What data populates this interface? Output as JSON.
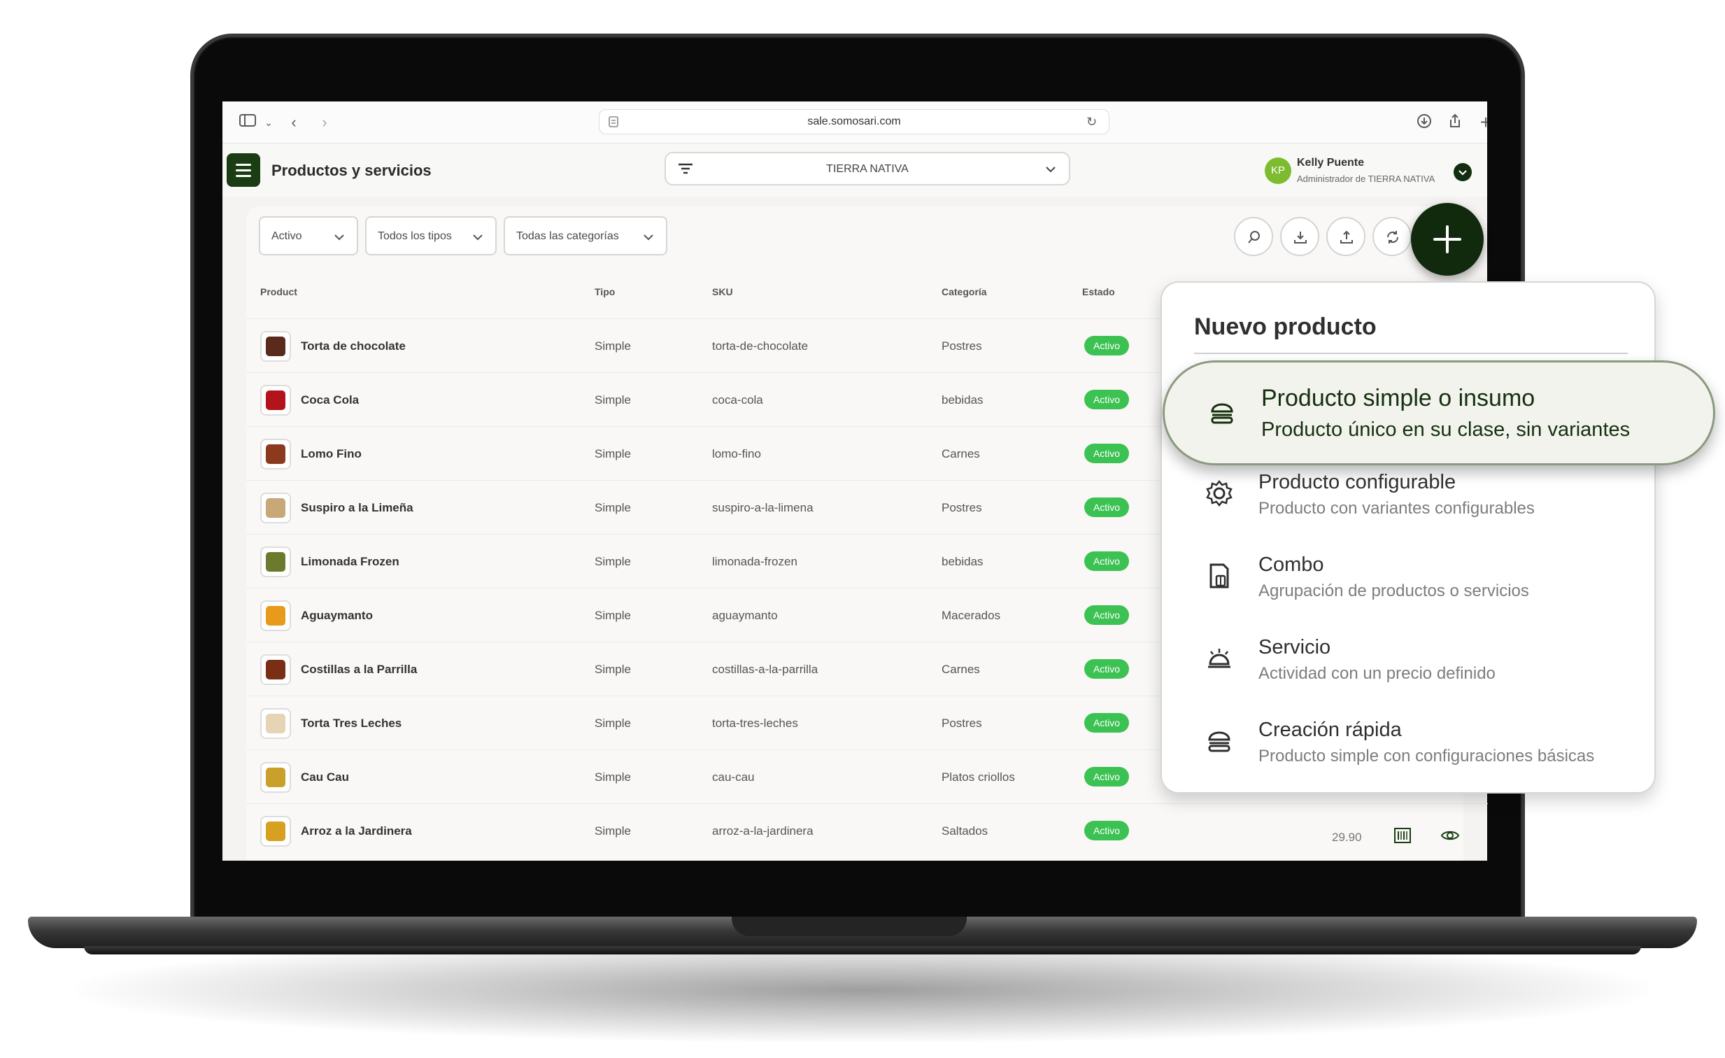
{
  "browser": {
    "url": "sale.somosari.com",
    "icons": [
      "sidebar-icon",
      "chevron-down-icon",
      "back-icon",
      "forward-icon",
      "download-icon",
      "share-icon",
      "new-tab-icon",
      "tabs-icon"
    ]
  },
  "header": {
    "title": "Productos y servicios",
    "store": "TIERRA NATIVA",
    "user": {
      "initials": "KP",
      "name": "Kelly Puente",
      "role": "Administrador de TIERRA NATIVA"
    }
  },
  "filters": {
    "status": "Activo",
    "type": "Todos los tipos",
    "category": "Todas las categorías"
  },
  "table": {
    "headers": {
      "product": "Product",
      "type": "Tipo",
      "sku": "SKU",
      "category": "Categoría",
      "status": "Estado"
    },
    "rows": [
      {
        "name": "Torta de chocolate",
        "type": "Simple",
        "sku": "torta-de-chocolate",
        "category": "Postres",
        "status": "Activo",
        "thumb_color": "#5a2a1c"
      },
      {
        "name": "Coca Cola",
        "type": "Simple",
        "sku": "coca-cola",
        "category": "bebidas",
        "status": "Activo",
        "thumb_color": "#b3141c"
      },
      {
        "name": "Lomo Fino",
        "type": "Simple",
        "sku": "lomo-fino",
        "category": "Carnes",
        "status": "Activo",
        "thumb_color": "#8b3a1e"
      },
      {
        "name": "Suspiro a la Limeña",
        "type": "Simple",
        "sku": "suspiro-a-la-limena",
        "category": "Postres",
        "status": "Activo",
        "thumb_color": "#c9a877"
      },
      {
        "name": "Limonada Frozen",
        "type": "Simple",
        "sku": "limonada-frozen",
        "category": "bebidas",
        "status": "Activo",
        "thumb_color": "#6b7a2c"
      },
      {
        "name": "Aguaymanto",
        "type": "Simple",
        "sku": "aguaymanto",
        "category": "Macerados",
        "status": "Activo",
        "thumb_color": "#e89a1a"
      },
      {
        "name": "Costillas a la Parrilla",
        "type": "Simple",
        "sku": "costillas-a-la-parrilla",
        "category": "Carnes",
        "status": "Activo",
        "thumb_color": "#7a2e16"
      },
      {
        "name": "Torta Tres Leches",
        "type": "Simple",
        "sku": "torta-tres-leches",
        "category": "Postres",
        "status": "Activo",
        "thumb_color": "#e7d4b4"
      },
      {
        "name": "Cau Cau",
        "type": "Simple",
        "sku": "cau-cau",
        "category": "Platos criollos",
        "status": "Activo",
        "thumb_color": "#c9a12a"
      },
      {
        "name": "Arroz a la Jardinera",
        "type": "Simple",
        "sku": "arroz-a-la-jardinera",
        "category": "Saltados",
        "status": "Activo",
        "thumb_color": "#d8a021"
      }
    ],
    "last_row_price": "29.90"
  },
  "dropdown": {
    "title": "Nuevo producto",
    "items": [
      {
        "label": "Producto simple o insumo",
        "sub": "Producto único en su clase, sin variantes",
        "icon": "burger-icon"
      },
      {
        "label": "Producto configurable",
        "sub": "Producto con variantes configurables",
        "icon": "gear-icon"
      },
      {
        "label": "Combo",
        "sub": "Agrupación de productos o servicios",
        "icon": "combo-icon"
      },
      {
        "label": "Servicio",
        "sub": "Actividad con un precio definido",
        "icon": "service-bell-icon"
      },
      {
        "label": "Creación rápida",
        "sub": "Producto simple con configuraciones básicas",
        "icon": "burger-icon"
      }
    ]
  },
  "colors": {
    "brand": "#1b3d14",
    "badge": "#3cc153",
    "avatar": "#7dbb2f"
  }
}
